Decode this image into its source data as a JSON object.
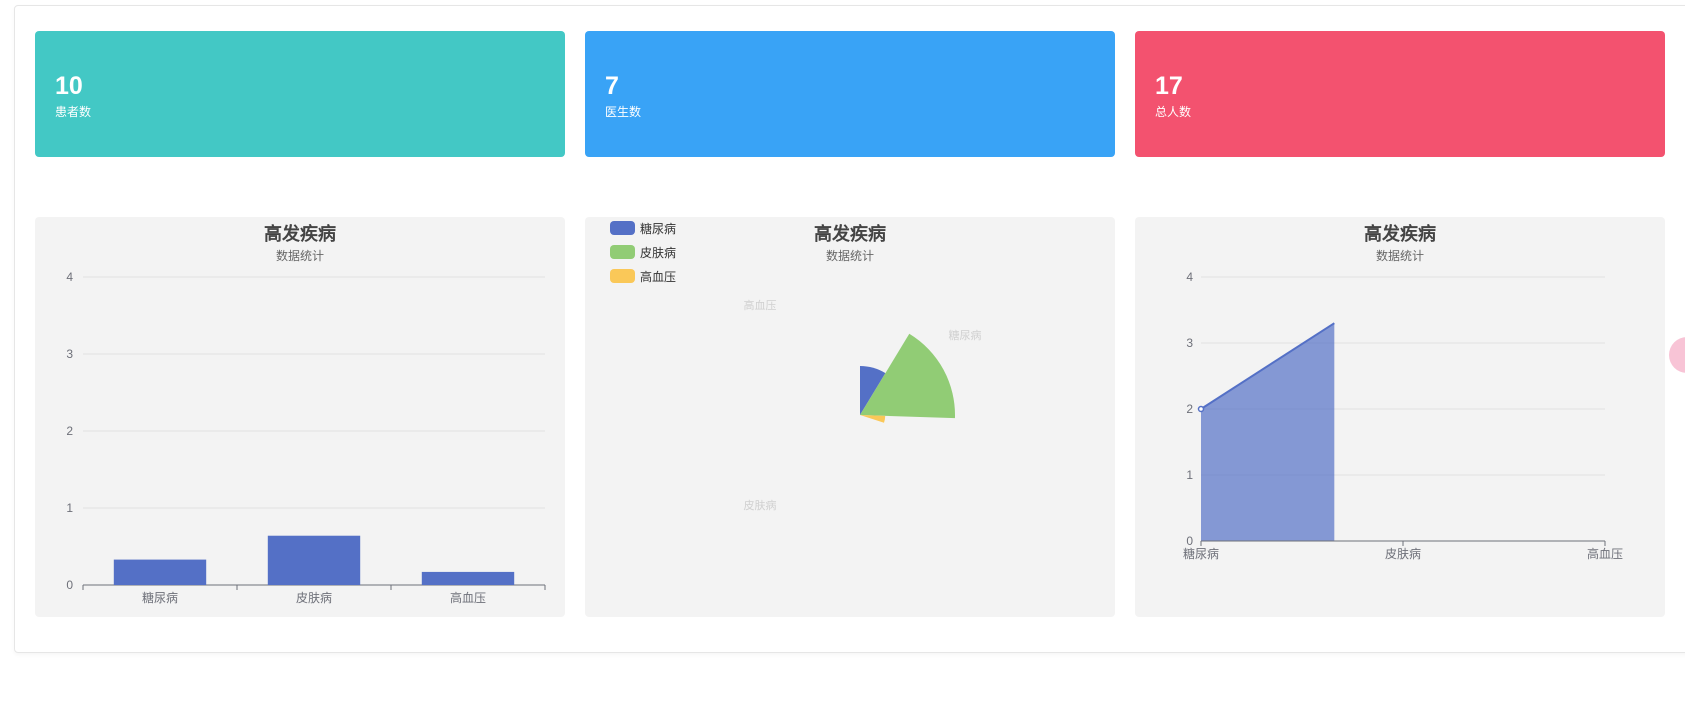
{
  "stats": [
    {
      "value": "10",
      "label": "患者数",
      "color": "#43c8c5"
    },
    {
      "value": "7",
      "label": "医生数",
      "color": "#39a3f6"
    },
    {
      "value": "17",
      "label": "总人数",
      "color": "#f3526f"
    }
  ],
  "charts": {
    "bar": {
      "title": "高发疾病",
      "subtitle": "数据统计"
    },
    "pie": {
      "title": "高发疾病",
      "subtitle": "数据统计"
    },
    "area": {
      "title": "高发疾病",
      "subtitle": "数据统计"
    }
  },
  "legend": [
    {
      "name": "糖尿病",
      "color": "#5470c6"
    },
    {
      "name": "皮肤病",
      "color": "#91cc75"
    },
    {
      "name": "高血压",
      "color": "#fac858"
    }
  ],
  "chart_data": [
    {
      "type": "bar",
      "title": "高发疾病",
      "subtitle": "数据统计",
      "categories": [
        "糖尿病",
        "皮肤病",
        "高血压"
      ],
      "values": [
        0.33,
        0.64,
        0.17
      ],
      "ylim": [
        0,
        4
      ],
      "yticks": [
        0,
        1,
        2,
        3,
        4
      ],
      "grid": true,
      "color": "#5470c6"
    },
    {
      "type": "pie",
      "title": "高发疾病",
      "subtitle": "数据统计",
      "rose": true,
      "categories": [
        "糖尿病",
        "皮肤病",
        "高血压"
      ],
      "values": [
        0.33,
        0.64,
        0.17
      ],
      "colors": [
        "#5470c6",
        "#91cc75",
        "#fac858"
      ],
      "legend": "top-left"
    },
    {
      "type": "area",
      "title": "高发疾病",
      "subtitle": "数据统计",
      "categories": [
        "糖尿病",
        "皮肤病",
        "高血压"
      ],
      "values": [
        2,
        3.3
      ],
      "ylim": [
        0,
        4
      ],
      "yticks": [
        0,
        1,
        2,
        3,
        4
      ],
      "grid": true,
      "color": "#5470c6"
    }
  ]
}
